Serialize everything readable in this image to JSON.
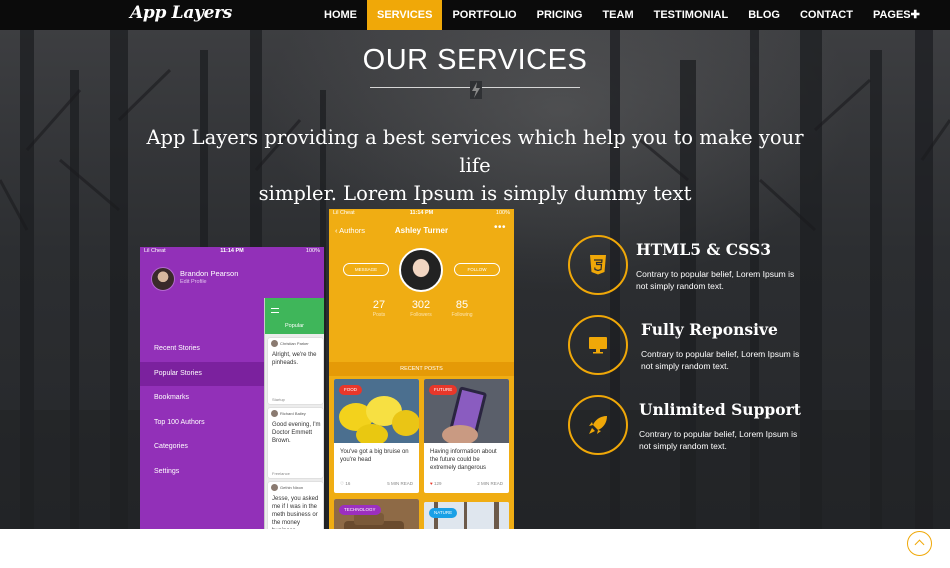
{
  "brand": {
    "logo": "App Layers",
    "accent_color": "#f0a808"
  },
  "nav": {
    "items": [
      {
        "label": "HOME",
        "active": false
      },
      {
        "label": "SERVICES",
        "active": true
      },
      {
        "label": "PORTFOLIO",
        "active": false
      },
      {
        "label": "PRICING",
        "active": false
      },
      {
        "label": "TEAM",
        "active": false
      },
      {
        "label": "TESTIMONIAL",
        "active": false
      },
      {
        "label": "BLOG",
        "active": false
      },
      {
        "label": "CONTACT",
        "active": false
      },
      {
        "label": "PAGES",
        "active": false,
        "suffix_icon": "plus-icon"
      }
    ]
  },
  "services": {
    "title": "OUR SERVICES",
    "divider_icon": "lightning-bolt-icon",
    "intro_line1": "App Layers providing a best services which help you to make your life",
    "intro_line2": "simpler. Lorem Ipsum is simply dummy text"
  },
  "phone_left": {
    "status": {
      "carrier": "Lil Cheat",
      "time": "11:14 PM",
      "battery": "100%"
    },
    "profile": {
      "name": "Brandon Pearson",
      "subtitle": "Edit Profile"
    },
    "menu": [
      "Recent Stories",
      "Popular Stories",
      "Bookmarks",
      "Top 100 Authors",
      "Categories",
      "Settings"
    ],
    "active_menu": "Popular Stories",
    "panel_tab": "Popular",
    "cards": [
      {
        "author": "Christian Parker",
        "text": "Alright, we're the pinheads.",
        "footer": "Startup"
      },
      {
        "author": "Richard Bailey",
        "text": "Good evening, I'm Doctor Emmett Brown.",
        "footer": "Freelance"
      },
      {
        "author": "Gethin Nixon",
        "text": "Jesse, you asked me if I was in the meth business or the money business.",
        "footer": ""
      }
    ]
  },
  "phone_right": {
    "status": {
      "carrier": "Lil Cheat",
      "time": "11:14 PM",
      "battery": "100%"
    },
    "back_label": "Authors",
    "title": "Ashley Turner",
    "message_button": "MESSAGE",
    "follow_button": "FOLLOW",
    "stats": [
      {
        "value": "27",
        "label": "Posts"
      },
      {
        "value": "302",
        "label": "Followers"
      },
      {
        "value": "85",
        "label": "Following"
      }
    ],
    "section_label": "RECENT POSTS",
    "posts": [
      {
        "tag": "FOOD",
        "tag_color": "#e8372a",
        "text": "You've got a big bruise on you're head",
        "likes": "16",
        "read": "5 MIN READ"
      },
      {
        "tag": "FUTURE",
        "tag_color": "#e8372a",
        "text": "Having information about the future could be extremely dangerous",
        "likes": "129",
        "read": "2 MIN READ"
      },
      {
        "tag": "TECHNOLOGY",
        "tag_color": "#9c2fc0",
        "text": "",
        "likes": "",
        "read": ""
      },
      {
        "tag": "NATURE",
        "tag_color": "#1aa0e6",
        "text": "",
        "likes": "",
        "read": ""
      }
    ]
  },
  "features": [
    {
      "icon": "html5-icon",
      "title": "HTML5 & CSS3",
      "desc_line1": "Contrary to popular belief, Lorem Ipsum is",
      "desc_line2": "not simply random text."
    },
    {
      "icon": "monitor-icon",
      "title": "Fully Reponsive",
      "desc_line1": "Contrary to popular belief, Lorem Ipsum is",
      "desc_line2": "not simply random text."
    },
    {
      "icon": "rocket-icon",
      "title": "Unlimited Support",
      "desc_line1": "Contrary to popular belief, Lorem Ipsum is",
      "desc_line2": "not simply random text."
    }
  ],
  "scroll_top": {
    "icon": "chevron-up-icon"
  }
}
